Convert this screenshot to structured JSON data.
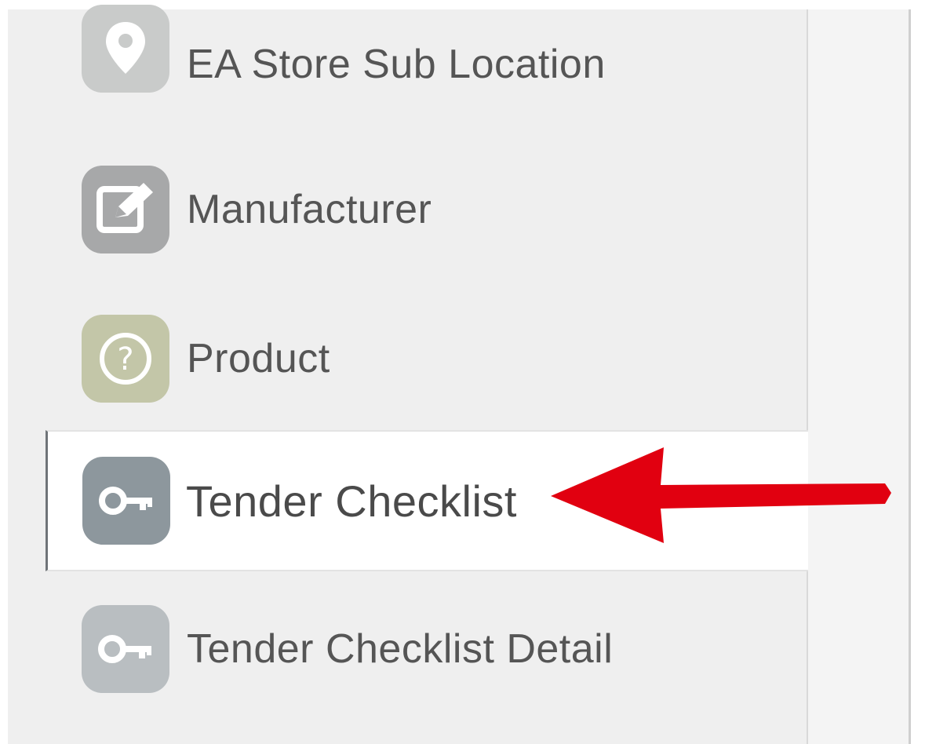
{
  "sidebar": {
    "items": [
      {
        "label": "EA Store Sub Location",
        "icon": "location-pin-icon",
        "selected": false
      },
      {
        "label": "Manufacturer",
        "icon": "edit-icon",
        "selected": false
      },
      {
        "label": "Product",
        "icon": "question-icon",
        "selected": false
      },
      {
        "label": "Tender Checklist",
        "icon": "key-icon",
        "selected": true
      },
      {
        "label": "Tender Checklist Detail",
        "icon": "key-icon",
        "selected": false
      }
    ]
  },
  "annotation": {
    "arrow_color": "#e10010",
    "points_to": "Tender Checklist"
  },
  "colors": {
    "sidebar_bg": "#efefef",
    "selected_bg": "#ffffff",
    "text": "#555555"
  }
}
